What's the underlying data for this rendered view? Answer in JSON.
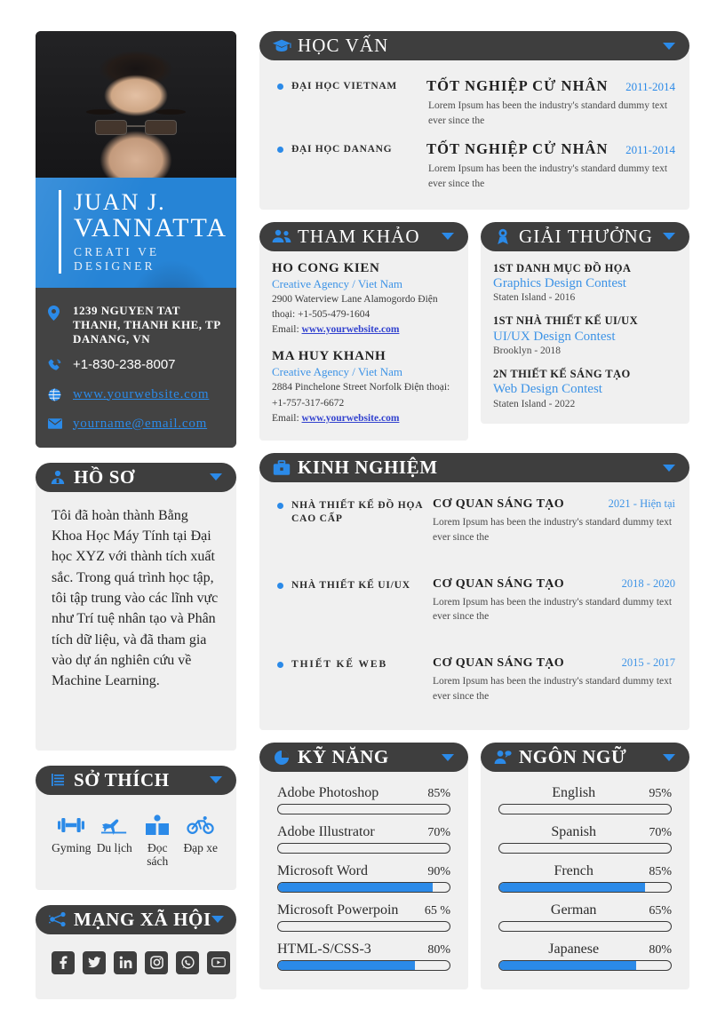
{
  "colors": {
    "accent_blue": "#2b8ae8",
    "header_dark": "#3e3e3e",
    "card_bg": "#f0f0f0",
    "banner_blue": "#2684d6",
    "link_blue": "#3242cf",
    "page_bg": "#ffffff"
  },
  "profile": {
    "photo_alt": "portrait-photo",
    "first_line": "JUAN J.",
    "second_line": "VANNATTA",
    "role": "CREATI VE DESIGNER",
    "contacts": [
      {
        "icon": "location-pin-icon",
        "text": "1239 NGUYEN TAT THANH, THANH KHE, TP DANANG, VN",
        "style": "bold"
      },
      {
        "icon": "phone-icon",
        "text": "+1-830-238-8007",
        "style": "plain"
      },
      {
        "icon": "globe-icon",
        "text": "www.yourwebsite.com",
        "style": "link"
      },
      {
        "icon": "envelope-icon",
        "text": "yourname@email.com",
        "style": "link"
      }
    ]
  },
  "education": {
    "title": "HỌC VẤN",
    "icon": "graduation-cap-icon",
    "items": [
      {
        "school": "ĐẠI HỌC VIETNAM",
        "degree": "TỐT NGHIỆP CỬ NHÂN",
        "year": "2011-2014",
        "desc": "Lorem Ipsum has been the industry's  standard dummy  text  ever  since the"
      },
      {
        "school": "ĐẠI HỌC DANANG",
        "degree": "TỐT NGHIỆP CỬ NHÂN",
        "year": "2011-2014",
        "desc": "Lorem Ipsum has been the industry's  standard dummy  text  ever  since the"
      }
    ]
  },
  "references": {
    "title": "THAM KHẢO",
    "icon": "people-icon",
    "items": [
      {
        "name": "HO CONG KIEN",
        "org": "Creative Agency / Viet Nam",
        "address": "2900 Waterview Lane Alamogordo  Điện thoại: +1-505-479-1604",
        "email_label": "Email:",
        "email_link": "www.yourwebsite.com"
      },
      {
        "name": "MA HUY KHANH",
        "org": "Creative Agency / Viet Nam",
        "address": "2884 Pinchelone Street Norfolk  Điện thoại: +1-757-317-6672",
        "email_label": "Email:",
        "email_link": "www.yourwebsite.com"
      }
    ]
  },
  "awards": {
    "title": "GIẢI THƯỞNG",
    "icon": "award-medal-icon",
    "items": [
      {
        "title": "1ST DANH MỤC ĐỒ HỌA",
        "contest": "Graphics Design Contest",
        "place": "Staten Island - 2016"
      },
      {
        "title": "1ST NHÀ THIẾT KẾ UI/UX",
        "contest": "UI/UX Design Contest",
        "place": "Brooklyn - 2018"
      },
      {
        "title": "2N THIẾT KẾ SÁNG TẠO",
        "contest": "Web Design Contest",
        "place": "Staten Island - 2022"
      }
    ]
  },
  "bio_section": {
    "title": "HỒ SƠ",
    "icon": "person-badge-icon",
    "text": "Tôi đã hoàn thành Bằng Khoa Học Máy Tính tại Đại học XYZ với thành tích xuất sắc. Trong quá trình học tập, tôi tập trung vào các lĩnh vực như Trí tuệ nhân tạo và Phân tích dữ liệu, và đã tham gia vào dự án nghiên cứu về Machine Learning."
  },
  "experience": {
    "title": "KINH NGHIỆM",
    "icon": "briefcase-icon",
    "items": [
      {
        "role": "NHÀ THIẾT KẾ ĐỒ HỌA CAO CẤP",
        "org": "CƠ QUAN SÁNG TẠO",
        "year": "2021 - Hiện tại",
        "desc": "Lorem Ipsum has been the industry's  standard dummy  text  ever  since the"
      },
      {
        "role": "NHÀ THIẾT KẾ UI/UX",
        "org": "CƠ QUAN SÁNG TẠO",
        "year": "2018 - 2020",
        "desc": "Lorem Ipsum has been the industry's  standard dummy  text  ever  since the"
      },
      {
        "role": "THIẾT KẾ WEB",
        "org": "CƠ QUAN SÁNG TẠO",
        "year": "2015 - 2017",
        "desc": "Lorem Ipsum has been the industry's  standard dummy  text  ever  since the"
      }
    ]
  },
  "hobbies": {
    "title": "SỞ THÍCH",
    "icon": "hobbies-icon",
    "items": [
      {
        "icon": "dumbbell-icon",
        "label": "Gyming"
      },
      {
        "icon": "airplane-icon",
        "label": "Du lịch"
      },
      {
        "icon": "open-book-icon",
        "label": "Đọc sách"
      },
      {
        "icon": "bicycle-icon",
        "label": "Đạp xe"
      }
    ]
  },
  "social": {
    "title": "MẠNG XÃ HỘI",
    "icon": "network-share-icon",
    "items": [
      {
        "icon": "facebook-icon",
        "name": "Facebook"
      },
      {
        "icon": "twitter-icon",
        "name": "Twitter"
      },
      {
        "icon": "linkedin-icon",
        "name": "LinkedIn"
      },
      {
        "icon": "instagram-icon",
        "name": "Instagram"
      },
      {
        "icon": "whatsapp-icon",
        "name": "WhatsApp"
      },
      {
        "icon": "youtube-icon",
        "name": "YouTube"
      }
    ]
  },
  "skills": {
    "title": "KỸ NĂNG",
    "icon": "pie-chart-icon",
    "items": [
      {
        "name": "Adobe Photoshop",
        "pct_label": "85%",
        "value": 85,
        "filled": false
      },
      {
        "name": "Adobe Illustrator",
        "pct_label": "70%",
        "value": 70,
        "filled": false
      },
      {
        "name": "Microsoft Word",
        "pct_label": "90%",
        "value": 90,
        "filled": true
      },
      {
        "name": "Microsoft Powerpoin",
        "pct_label": "65 %",
        "value": 65,
        "filled": false
      },
      {
        "name": "HTML-S/CSS-3",
        "pct_label": "80%",
        "value": 80,
        "filled": true
      }
    ]
  },
  "languages": {
    "title": "NGÔN NGỮ",
    "icon": "person-speech-icon",
    "items": [
      {
        "name": "English",
        "pct_label": "95%",
        "value": 95,
        "filled": false
      },
      {
        "name": "Spanish",
        "pct_label": "70%",
        "value": 70,
        "filled": false
      },
      {
        "name": "French",
        "pct_label": "85%",
        "value": 85,
        "filled": true
      },
      {
        "name": "German",
        "pct_label": "65%",
        "value": 65,
        "filled": false
      },
      {
        "name": "Japanese",
        "pct_label": "80%",
        "value": 80,
        "filled": true
      }
    ]
  }
}
